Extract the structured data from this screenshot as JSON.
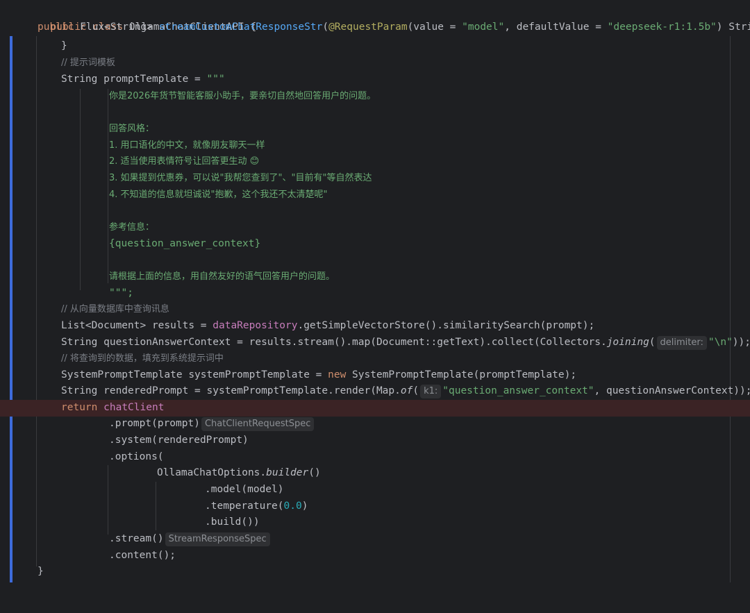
{
  "code": {
    "class_decl": {
      "kw": "public class",
      "name": "OllamaChatClientAPI",
      "brace": "{"
    },
    "method_sig": {
      "kw": "public",
      "ret": "Flux<String>",
      "name": "streamCustomChatResponseStr",
      "open": "(",
      "annotation": "@RequestParam",
      "p1": "(value = ",
      "s1": "\"model\"",
      "p2": ", defaultValue = ",
      "s2": "\"deepseek-r1:1.5b\"",
      "p3": ") String"
    },
    "close_if": "}",
    "comment_template": "// 提示词模板",
    "prompt_decl": {
      "pre": "String promptTemplate = ",
      "str": "\"\"\""
    },
    "template_lines": [
      "你是2026年货节智能客服小助手，要亲切自然地回答用户的问题。",
      "",
      "回答风格：",
      "1. 用口语化的中文，就像朋友聊天一样",
      "2. 适当使用表情符号让回答更生动 😊",
      "3. 如果提到优惠券，可以说\"我帮您查到了\"、\"目前有\"等自然表达",
      "4. 不知道的信息就坦诚说\"抱歉，这个我还不太清楚呢\"",
      "",
      "参考信息：",
      "{question_answer_context}",
      "",
      "请根据上面的信息，用自然友好的语气回答用户的问题。"
    ],
    "template_end": "\"\"\";",
    "comment_query": "// 从向量数据库中查询讯息",
    "results_line": {
      "pre": "List<Document> results = ",
      "field": "dataRepository",
      "post": ".getSimpleVectorStore().similaritySearch(prompt);"
    },
    "context_line": {
      "pre": "String questionAnswerContext = results.stream().map(Document::getText).collect(Collectors.",
      "it": "joining",
      "open": "(",
      "hint": "delimiter:",
      "str": "\"\\n\"",
      "post": "));"
    },
    "comment_fill": "// 将查询到的数据，填充到系统提示词中",
    "spt_line": {
      "pre": "SystemPromptTemplate systemPromptTemplate = ",
      "kw": "new",
      "post": " SystemPromptTemplate(promptTemplate);"
    },
    "rendered_line": {
      "pre": "String renderedPrompt = systemPromptTemplate.render(Map.",
      "it": "of",
      "open": "(",
      "hint": "k1:",
      "str": "\"question_answer_context\"",
      "post": ", questionAnswerContext));"
    },
    "return_line": {
      "kw": "return",
      "field": "chatClient"
    },
    "prompt_call": {
      "text": ".prompt(prompt)",
      "hint": "ChatClientRequestSpec"
    },
    "system_call": ".system(renderedPrompt)",
    "options_call": ".options(",
    "builder_line": {
      "pre": "OllamaChatOptions.",
      "it": "builder",
      "post": "()"
    },
    "model_call": ".model(model)",
    "temp_call": {
      "pre": ".temperature(",
      "num": "0.0",
      "post": ")"
    },
    "build_call": ".build())",
    "stream_call": {
      "text": ".stream()",
      "hint": "StreamResponseSpec"
    },
    "content_call": ".content();",
    "method_close": "}"
  },
  "colors": {
    "background": "#1e1f22",
    "keyword": "#cf8e6d",
    "function": "#56a8f5",
    "string": "#6aab73",
    "field": "#c77dbb",
    "comment": "#7a7e85",
    "annotation": "#b3ae60",
    "number": "#2aacb8"
  }
}
